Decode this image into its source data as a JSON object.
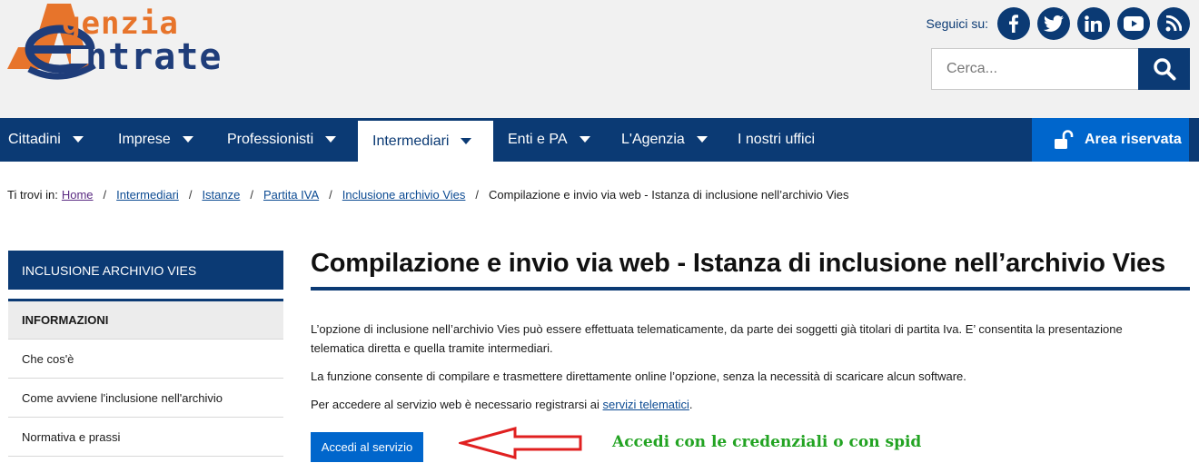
{
  "logo": {
    "line1": "genzia",
    "line2": "ntrate"
  },
  "social": {
    "label": "Seguici su:",
    "icons": [
      "facebook-icon",
      "twitter-icon",
      "linkedin-icon",
      "youtube-icon",
      "rss-icon"
    ]
  },
  "search": {
    "placeholder": "Cerca..."
  },
  "nav": {
    "items": [
      {
        "label": "Cittadini"
      },
      {
        "label": "Imprese"
      },
      {
        "label": "Professionisti"
      },
      {
        "label": "Intermediari"
      },
      {
        "label": "Enti e PA"
      },
      {
        "label": "L'Agenzia"
      },
      {
        "label": "I nostri uffici"
      }
    ],
    "reserved_label": "Area riservata"
  },
  "breadcrumb": {
    "label": "Ti trovi in:",
    "links": [
      "Home",
      "Intermediari",
      "Istanze",
      "Partita IVA",
      "Inclusione archivio Vies "
    ],
    "current": "Compilazione e invio via web - Istanza di inclusione nell’archivio Vies"
  },
  "sidebar": {
    "title": "INCLUSIONE ARCHIVIO VIES",
    "items": [
      {
        "label": "INFORMAZIONI"
      },
      {
        "label": "Che cos'è"
      },
      {
        "label": "Come avviene l'inclusione nell'archivio"
      },
      {
        "label": "Normativa e prassi"
      }
    ]
  },
  "main": {
    "title": "Compilazione e invio via web - Istanza di inclusione nell’archivio Vies",
    "p1_line1": "L’opzione di inclusione nell’archivio Vies può essere effettuata telematicamente, da parte dei soggetti già titolari di partita Iva. E’ consentita la presentazione",
    "p1_line2": "telematica diretta e quella tramite intermediari.",
    "p2": "La funzione consente di compilare e trasmettere direttamente online l’opzione, senza la necessità di scaricare alcun software.",
    "p3_text": "Per accedere al servizio web è necessario registrarsi ai ",
    "p3_link": "servizi telematici",
    "p3_end": ".",
    "access_button": "Accedi al servizio",
    "annotation": "Accedi con le credenziali o con spid"
  },
  "colors": {
    "brand_blue": "#0b3a74",
    "action_blue": "#0066cc",
    "logo_orange": "#e7742b",
    "annotation_green": "#22a322",
    "arrow_red": "#e02020"
  }
}
